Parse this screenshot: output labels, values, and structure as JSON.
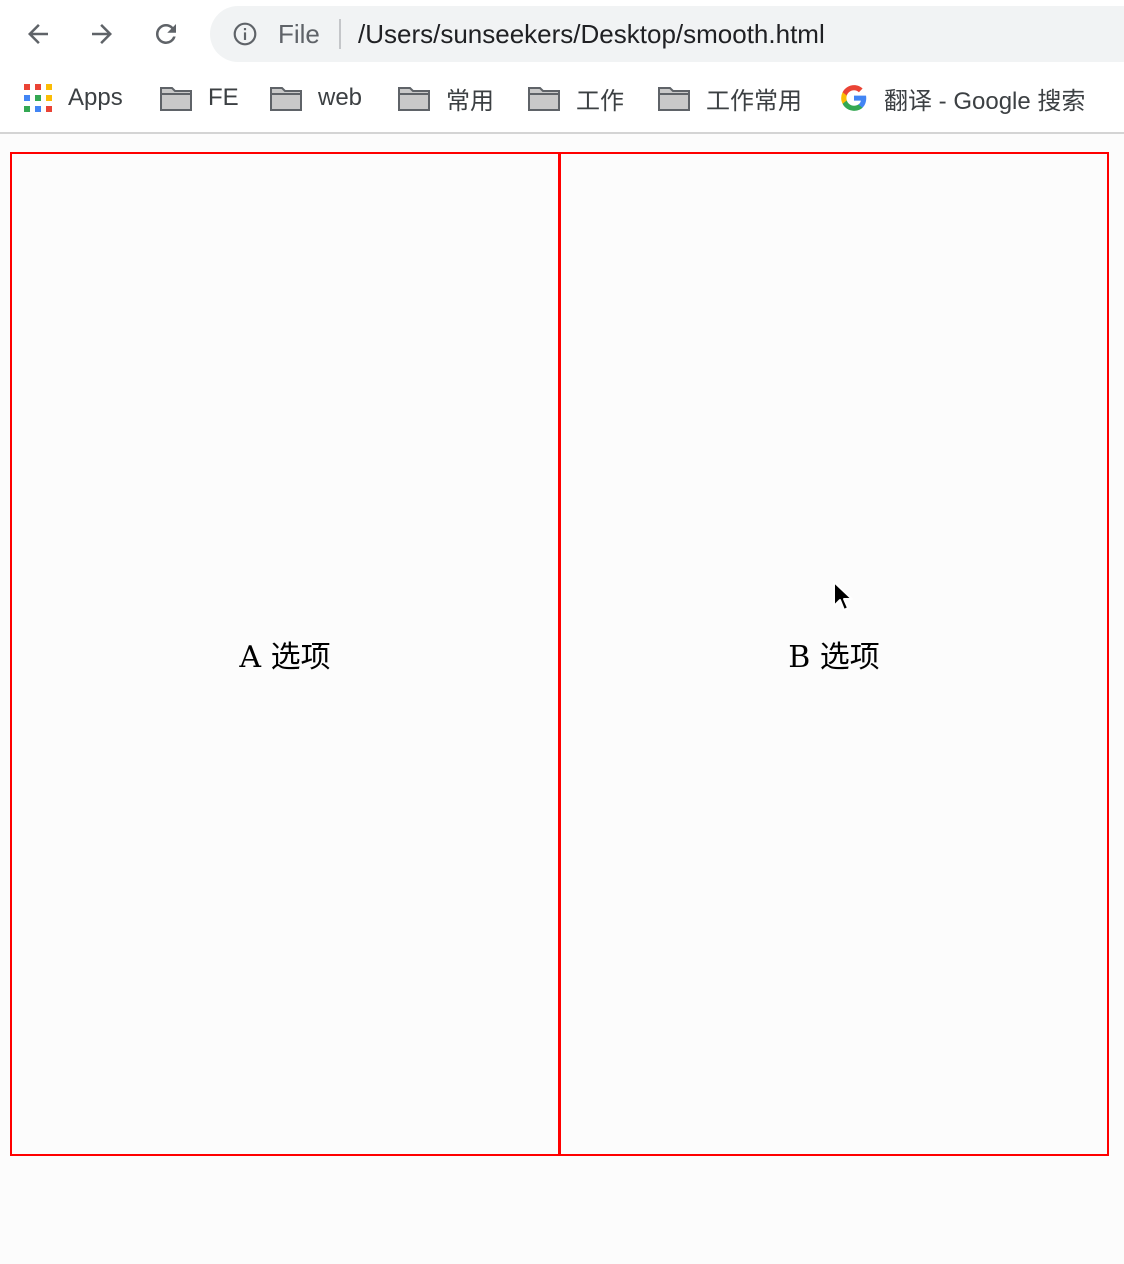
{
  "browser": {
    "nav": {
      "back_icon": "arrow-left-icon",
      "forward_icon": "arrow-right-icon",
      "reload_icon": "reload-icon"
    },
    "omnibox": {
      "scheme_label": "File",
      "url": "/Users/sunseekers/Desktop/smooth.html"
    },
    "bookmarks": [
      {
        "label": "Apps",
        "icon": "apps-grid-icon"
      },
      {
        "label": "FE",
        "icon": "folder-icon"
      },
      {
        "label": "web",
        "icon": "folder-icon"
      },
      {
        "label": "常用",
        "icon": "folder-icon"
      },
      {
        "label": "工作",
        "icon": "folder-icon"
      },
      {
        "label": "工作常用",
        "icon": "folder-icon"
      },
      {
        "label": "翻译 - Google 搜索",
        "icon": "google-icon"
      }
    ]
  },
  "page": {
    "options": [
      {
        "label": "A 选项"
      },
      {
        "label": "B 选项"
      }
    ],
    "border_color": "#ff0000"
  }
}
